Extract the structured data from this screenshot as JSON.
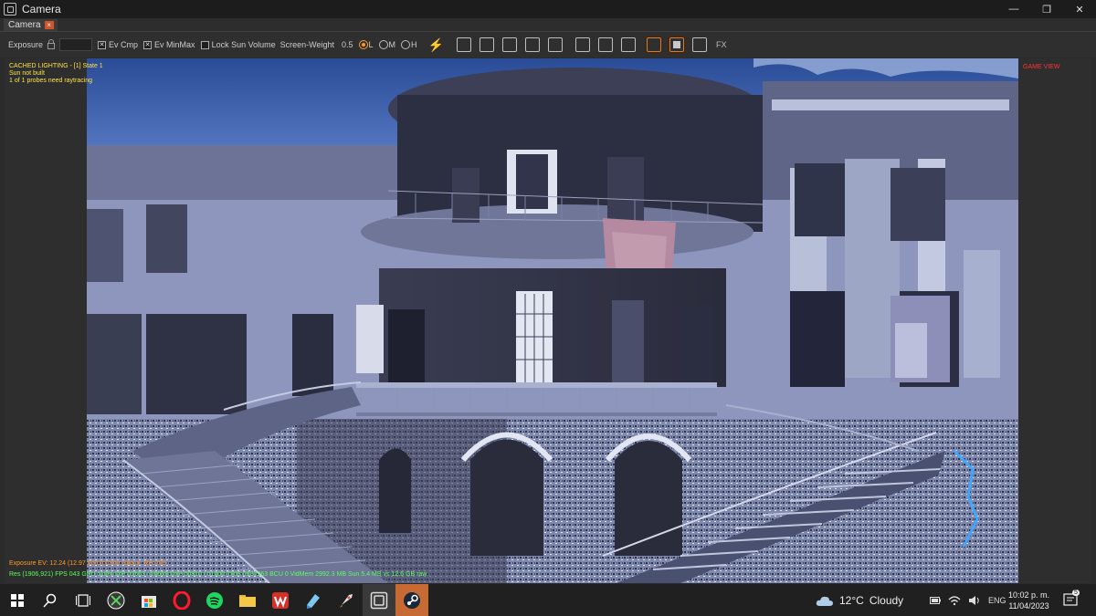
{
  "window": {
    "title": "Camera",
    "minimize": "—",
    "maximize": "❐",
    "close": "✕"
  },
  "tab": {
    "label": "Camera",
    "close": "×"
  },
  "toolbar": {
    "exposure_label": "Exposure",
    "ev_cmp": "Ev Cmp",
    "ev_minmax": "Ev MinMax",
    "lock_sun_volume": "Lock Sun Volume",
    "screen_weight_label": "Screen-Weight",
    "screen_weight_value": "0.5",
    "radio_l": "L",
    "radio_m": "M",
    "radio_h": "H",
    "fx": "FX"
  },
  "viewport": {
    "cached_lighting": "CACHED LIGHTING - [1] State 1",
    "sun_status": "Sun not built",
    "probes_status": "1 of 1 probes need raytracing",
    "game_view": "GAME VIEW",
    "exposure_ev": "Exposure EV: 12.24 (12.97 GPU)  Color Space: Rec709",
    "stats": "Res (1906,921)  FPS 043  GPU 110%  DIP 00553 / 00659  DIIP 00810 / 01000  TRIS 0637963  BCU 0  VidMem 2992.3 MB  Sun 5.4 MB vs 12.6 GB raw"
  },
  "taskbar": {
    "weather_temp": "12°C",
    "weather_desc": "Cloudy",
    "language": "ENG",
    "time": "10:02 p. m.",
    "date": "11/04/2023",
    "notification_count": "5"
  },
  "colors": {
    "accent": "#d97b2a",
    "steam_active": "#c86a33",
    "overlay_yellow": "#ffe24a",
    "overlay_green": "#5aff5a",
    "overlay_red": "#ff3333"
  }
}
